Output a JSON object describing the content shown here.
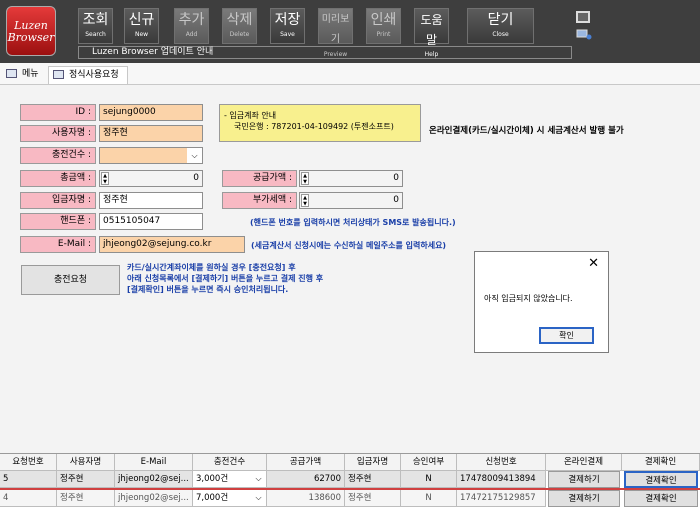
{
  "app": {
    "logo_line1": "Luzen",
    "logo_line2": "Browser"
  },
  "toolbar": {
    "buttons": [
      {
        "big": "조회",
        "small": "Search"
      },
      {
        "big": "신규",
        "small": "New"
      },
      {
        "big": "추가",
        "small": "Add"
      },
      {
        "big": "삭제",
        "small": "Delete"
      },
      {
        "big": "저장",
        "small": "Save"
      },
      {
        "big": "미리보기",
        "small": "Preview"
      },
      {
        "big": "인쇄",
        "small": "Print"
      },
      {
        "big": "도움말",
        "small": "Help"
      },
      {
        "big": "닫기",
        "small": "Close"
      }
    ],
    "notice": "Luzen Browser 업데이트 안내"
  },
  "tabs": {
    "menu": "메뉴",
    "active": "정식사용요청"
  },
  "form": {
    "id_label": "ID :",
    "id_value": "sejung0000",
    "user_label": "사용자명 :",
    "user_value": "정주현",
    "charge_label": "충전건수 :",
    "charge_value": "",
    "total_label": "총금액 :",
    "total_value": "0",
    "supply_label": "공급가액 :",
    "supply_value": "0",
    "depositor_label": "입금자명 :",
    "depositor_value": "정주현",
    "vat_label": "부가세액 :",
    "vat_value": "0",
    "phone_label": "핸드폰 :",
    "phone_value": "0515105047",
    "email_label": "E-Mail :",
    "email_value": "jhjeong02@sejung.co.kr"
  },
  "info": {
    "line1": "- 입금계좌 안내",
    "line2": "국민은행 : 787201-04-109492 (투젠소프트)",
    "online_note": "온라인결제(카드/실시간이체) 시 세금계산서 발행 불가",
    "phone_note": "(핸드폰 번호를 입력하시면 처리상태가 SMS로 발송됩니다.)",
    "email_note": "(세금계산서 신청시에는 수신하실 메일주소를 입력하세요)"
  },
  "charge": {
    "button": "충전요청",
    "note1": "카드/실시간계좌이체를 원하실 경우 [충전요청] 후",
    "note2": "아래 신청목록에서 [결제하기] 버튼을 누르고 결제 진행 후",
    "note3": "[결제확인] 버튼을 누르면 즉시 승인처리됩니다."
  },
  "dialog": {
    "message": "아직 입금되지 않았습니다.",
    "ok": "확인",
    "close": "✕"
  },
  "grid": {
    "headers": [
      "요청번호",
      "사용자명",
      "E-Mail",
      "충전건수",
      "공급가액",
      "입금자명",
      "승인여부",
      "신청번호",
      "온라인결제",
      "결제확인"
    ],
    "rows": [
      [
        "5",
        "정주현",
        "jhjeong02@sej...",
        "3,000건",
        "62700",
        "정주현",
        "N",
        "17478009413894",
        "결제하기",
        "결제확인"
      ],
      [
        "4",
        "정주현",
        "jhjeong02@sej...",
        "7,000건",
        "138600",
        "정주현",
        "N",
        "17472175129857",
        "결제하기",
        "결제확인"
      ]
    ]
  }
}
